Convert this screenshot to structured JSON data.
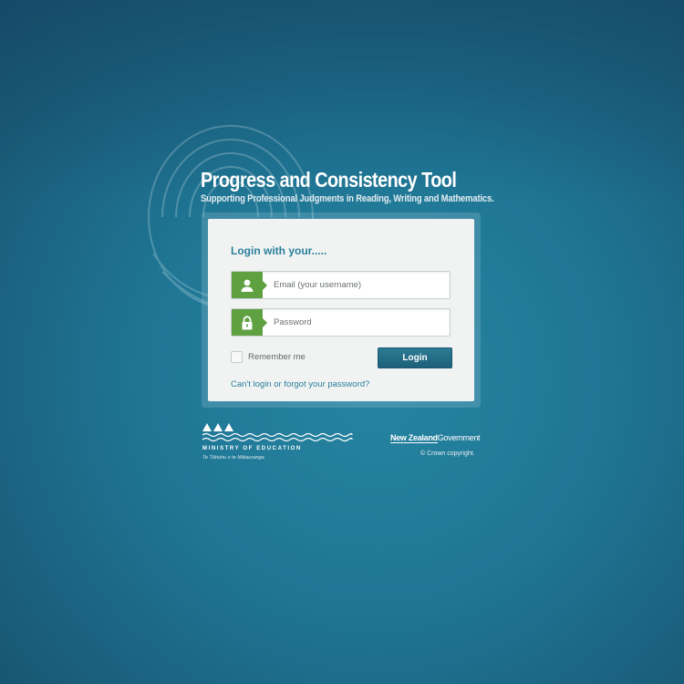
{
  "header": {
    "title": "Progress and Consistency Tool",
    "subtitle": "Supporting Professional Judgments in Reading, Writing and Mathematics."
  },
  "login": {
    "heading": "Login with your.....",
    "email": {
      "placeholder": "Email (your username)",
      "value": "",
      "icon": "user-icon"
    },
    "password": {
      "placeholder": "Password",
      "value": "",
      "icon": "lock-icon"
    },
    "remember_label": "Remember me",
    "remember_checked": false,
    "login_button": "Login",
    "forgot_link": "Can't login or forgot your password?"
  },
  "footer": {
    "ministry_name": "MINISTRY OF EDUCATION",
    "ministry_maori": "Te Tāhuhu o te Mātauranga",
    "nzgov_part1": "New Zealand",
    "nzgov_part2": "Government",
    "copyright": "© Crown copyright."
  },
  "colors": {
    "background": "#1f7594",
    "accent": "#2a7f99",
    "icon_green": "#5fa040",
    "button": "#1d5f78"
  }
}
